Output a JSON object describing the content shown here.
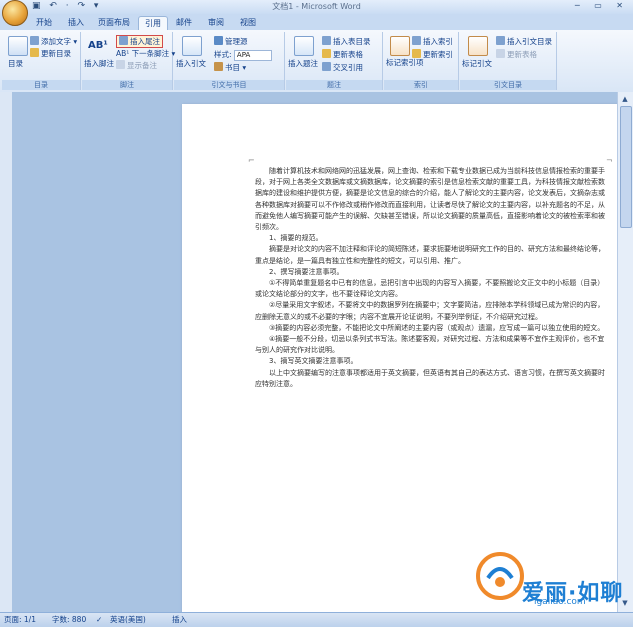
{
  "window": {
    "title": "文档1 - Microsoft Word",
    "quick_access": "▣ ↶ · ↷ ▾",
    "controls": "─ ▭ ✕"
  },
  "tabs": [
    {
      "label": "开始"
    },
    {
      "label": "插入"
    },
    {
      "label": "页面布局"
    },
    {
      "label": "引用"
    },
    {
      "label": "邮件"
    },
    {
      "label": "审阅"
    },
    {
      "label": "视图"
    }
  ],
  "ribbon": {
    "toc": {
      "label": "目录",
      "add_text": "添加文字 ▾",
      "update_toc": "更新目录",
      "group": "目录"
    },
    "footnotes": {
      "insert_footnote": "插入脚注",
      "insert_endnote": "插入尾注",
      "next_footnote": "AB¹ 下一条脚注 ▾",
      "show_notes": "显示备注",
      "group": "脚注",
      "icon_text": "AB¹"
    },
    "citations": {
      "insert_citation": "插入引文",
      "manage_sources": "管理源",
      "style_label": "样式:",
      "style_value": "APA",
      "bibliography": "书目 ▾",
      "group": "引文与书目"
    },
    "captions": {
      "insert_caption": "插入题注",
      "insert_table_of_figures": "插入表目录",
      "update_table": "更新表格",
      "cross_reference": "交叉引用",
      "group": "题注"
    },
    "index": {
      "mark_entry": "标记索引项",
      "insert_index": "插入索引",
      "update_index": "更新索引",
      "group": "索引"
    },
    "toa": {
      "mark_citation": "标记引文",
      "insert_toa": "插入引文目录",
      "update_toa": "更新表格",
      "group": "引文目录"
    }
  },
  "document": {
    "paragraphs": [
      {
        "text": "随着计算机技术和网络网的迅猛发展，网上查询、检索和下载专业数据已成为当前科技信息情报检索的重要手段，对于网上各类全文数据库或文摘数据库，论文摘要的索引是信息检索文献的重要工具，为科技情报文献检索数据库的建设和维护提供方便，摘要是论文信息的综合的介绍，能人了解论文的主要内容，论文发表后，文摘杂志或各种数据库对摘要可以不作修改或稍作修改而直接利用，让读者尽快了解论文的主要内容，以补充题名的不足，从而避免他人编写摘要可能产生的误解、欠缺甚至错误，所以论文摘要的质量高低，直接影响着论文的被检索率和被引频次。",
        "kind": "body"
      },
      {
        "text": "1、摘要的规范。",
        "kind": "heading"
      },
      {
        "text": "摘要是对论文的内容不加注释和评论的简短陈述，要求扼要地说明研究工作的目的、研究方法和最终结论等，重点是结论，是一篇具有独立性和完整性的短文，可以引用、推广。",
        "kind": "body"
      },
      {
        "text": "2、撰写摘要注意事项。",
        "kind": "heading"
      },
      {
        "text": "①不得简单重复题名中已有的信息，忌把引言中出现的内容写入摘要，不要照搬论文正文中的小标题（目录）或论文结论部分的文字，也不要诠释论文内容。",
        "kind": "body"
      },
      {
        "text": "②尽量采用文字叙述，不要将文中的数据罗列在摘要中；文字要简洁，应排除本学科领域已成为常识的内容，应删除无意义的或不必要的字眼；内容不宜展开论证说明，不要列举例证，不介绍研究过程。",
        "kind": "body"
      },
      {
        "text": "③摘要的内容必须完整，不能把论文中所阐述的主要内容（或观点）遗漏，应写成一篇可以独立使用的短文。",
        "kind": "body"
      },
      {
        "text": "④摘要一般不分段，切忌以条列式书写法。陈述要客观，对研究过程、方法和成果等不宜作主观评价，也不宜与别人的研究作对比说明。",
        "kind": "body"
      },
      {
        "text": "3、摘写英文摘要注意事项。",
        "kind": "heading"
      },
      {
        "text": "以上中文摘要编写的注意事项都适用于英文摘要，但英语有其自己的表达方式、语言习惯，在撰写英文摘要时应特别注意。",
        "kind": "body"
      }
    ]
  },
  "statusbar": {
    "page": "页面: 1/1",
    "words": "字数: 880",
    "lang": "英语(美国)",
    "mode": "插入"
  },
  "watermark": {
    "text": "爱丽·如聊",
    "url": "igaliao.com",
    "url2": "q9ufu.com"
  },
  "colors": {
    "accent": "#15428b",
    "ribbon_bg": "#d9e6f6",
    "workspace": "#a9c3e2",
    "highlight_border": "#d24a4a"
  }
}
